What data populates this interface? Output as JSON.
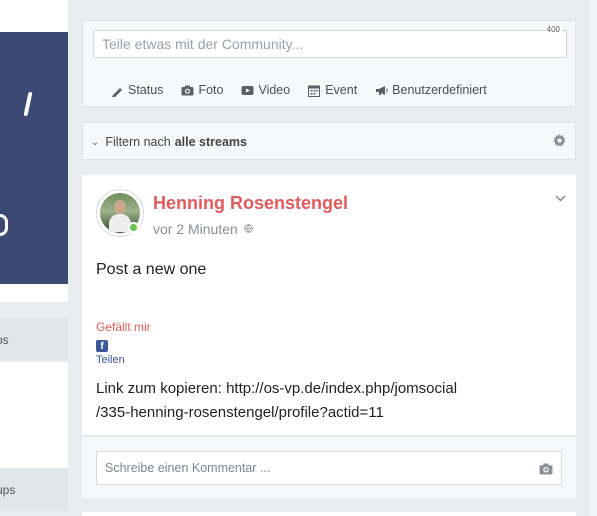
{
  "left": {
    "tab1_label": "os",
    "tab2_label": "ups"
  },
  "composer": {
    "placeholder": "Teile etwas mit der Community...",
    "char_count": "400",
    "actions": [
      {
        "label": "Status",
        "icon": "pencil-icon"
      },
      {
        "label": "Foto",
        "icon": "camera-icon"
      },
      {
        "label": "Video",
        "icon": "video-icon"
      },
      {
        "label": "Event",
        "icon": "calendar-icon"
      },
      {
        "label": "Benutzerdefiniert",
        "icon": "megaphone-icon"
      }
    ]
  },
  "filter": {
    "prefix": "Filtern nach",
    "value": "alle streams"
  },
  "post": {
    "author": "Henning Rosenstengel",
    "time": "vor 2 Minuten",
    "content": "Post a new one",
    "like_label": "Gefällt mir",
    "share_label": "Teilen",
    "link_text": "Link zum kopieren: http://os-vp.de/index.php/jomsocial/335-henning-rosenstengel/profile?actid=11",
    "link_line1": "Link zum kopieren: http://os-vp.de/index.php/jomsocial",
    "link_line2": "/335-henning-rosenstengel/profile?actid=11"
  },
  "comment": {
    "placeholder": "Schreibe einen Kommentar ..."
  },
  "colors": {
    "accent": "#e35a5a",
    "online": "#6cc04a",
    "facebook": "#3b5998",
    "banner": "#3b4a72"
  }
}
